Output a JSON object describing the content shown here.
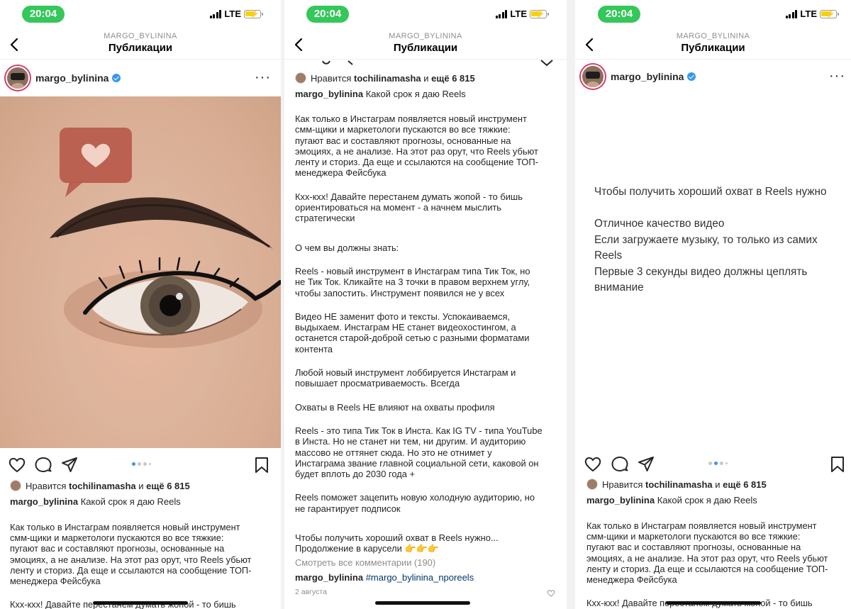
{
  "status": {
    "time": "20:04",
    "network": "LTE"
  },
  "header": {
    "account": "MARGO_BYLININA",
    "title": "Публикации"
  },
  "post": {
    "username": "margo_bylinina",
    "liked_by": "tochilinamasha",
    "likes_prefix": "Нравится",
    "likes_join": "и",
    "likes_count": "ещё 6 815",
    "caption_title": "Какой срок я даю Reels",
    "paragraph_1": "Как только в Инстаграм появляется новый инструмент\nсмм-щики и маркетологи пускаются во все тяжкие:\nпугают вас и составляют прогнозы, основанные на\nэмоциях, а не анализе. На этот раз орут, что Reels убьют\nленту и сториз. Да еще и ссылаются на сообщение ТОП-\nменеджера Фейсбука",
    "paragraph_2_start": "Кхх-кхх! Давайте перестанем думать жопой - то бишь",
    "paragraph_2": "Кхх-кхх! Давайте перестанем думать жопой - то бишь\nориентироваться на момент - а начнем мыслить\nстратегически",
    "paragraph_3": "О чем вы должны знать:",
    "paragraph_4": "Reels - новый инструмент в Инстаграм типа Тик Ток, но\nне Тик Ток. Кликайте на 3 точки в правом верхнем углу,\nчтобы запостить. Инструмент появился не у всех",
    "paragraph_5": "Видео НЕ заменит фото и тексты. Успокаиваемся,\nвыдыхаем. Инстаграм НЕ станет видеохостингом, а\nостанется старой-доброй сетью с разными форматами\nконтента",
    "paragraph_6": "Любой новый инструмент лоббируется Инстаграм и\nповышает просматриваемость. Всегда",
    "paragraph_7": "Охваты в Reels НЕ влияют на охваты профиля",
    "paragraph_8": "Reels - это типа Тик Ток в Инста. Как IG TV - типа YouTube\nв Инста. Но не станет ни тем, ни другим. И аудиторию\nмассово не оттянет сюда. Но это не отнимет у\nИнстаграма звание главной социальной сети, каковой он\nбудет вплоть до 2030 года +",
    "paragraph_9": "Reels поможет зацепить новую холодную аудиторию, но\nне гарантирует подписок",
    "paragraph_10": "Чтобы получить хороший охват в  Reels нужно...\nПродолжение в карусели 👉👉👉",
    "view_comments": "Смотреть все комментарии (190)",
    "hashtag": "#margo_bylinina_nporeels",
    "date": "2 августа"
  },
  "slide3": {
    "text": "Чтобы получить хороший охват в  Reels нужно\n\nОтличное качество видео\nЕсли загружаете музыку, то только из самих\nReels\nПервые 3 секунды видео должны цеплять\nвнимание"
  },
  "colors": {
    "accent": "#3897f0",
    "status_green": "#34c759",
    "heart_sticker": "#b85a4c"
  }
}
